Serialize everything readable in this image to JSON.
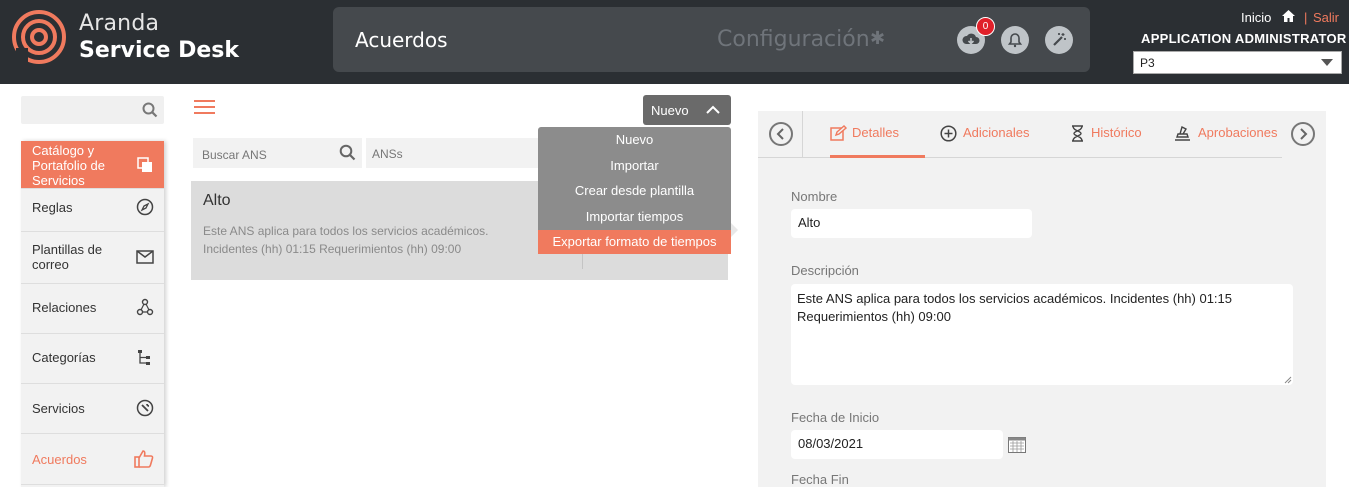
{
  "header": {
    "brand_line1": "Aranda",
    "brand_line2": "Service Desk",
    "module_title": "Acuerdos",
    "config_label": "Configuración",
    "download_badge": "0",
    "inicio_label": "Inicio",
    "separator": "|",
    "salir_label": "Salir",
    "user_role": "APPLICATION ADMINISTRATOR",
    "project_selected": "P3",
    "accent_color": "#f07a5e",
    "icons": [
      "download-icon",
      "bell-icon",
      "magic-wand-icon",
      "gear-icon",
      "home-icon"
    ]
  },
  "sidebar": {
    "search_placeholder": "",
    "items": [
      {
        "label": "Catálogo y Portafolio de Servicios",
        "icon": "copy-icon"
      },
      {
        "label": "Reglas",
        "icon": "compass-icon"
      },
      {
        "label": "Plantillas de correo",
        "icon": "mail-icon"
      },
      {
        "label": "Relaciones",
        "icon": "relations-icon"
      },
      {
        "label": "Categorías",
        "icon": "tree-icon"
      },
      {
        "label": "Servicios",
        "icon": "wrench-icon"
      },
      {
        "label": "Acuerdos",
        "icon": "thumbs-up-icon"
      }
    ]
  },
  "list": {
    "nuevo_button": "Nuevo",
    "dropdown": [
      "Nuevo",
      "Importar",
      "Crear desde plantilla",
      "Importar tiempos",
      "Exportar formato de tiempos"
    ],
    "search_placeholder": "Buscar ANS",
    "filter_value": "ANSs",
    "card": {
      "title": "Alto",
      "description": "Este ANS aplica para todos los servicios académicos. Incidentes (hh) 01:15 Requerimientos (hh) 09:00"
    }
  },
  "detail": {
    "tabs": [
      "Detalles",
      "Adicionales",
      "Histórico",
      "Aprobaciones"
    ],
    "nombre_label": "Nombre",
    "nombre_value": "Alto",
    "descripcion_label": "Descripción",
    "descripcion_value": "Este ANS aplica para todos los servicios académicos. Incidentes (hh) 01:15 Requerimientos (hh) 09:00",
    "fecha_inicio_label": "Fecha de Inicio",
    "fecha_inicio_value": "08/03/2021",
    "fecha_fin_label": "Fecha Fin"
  }
}
